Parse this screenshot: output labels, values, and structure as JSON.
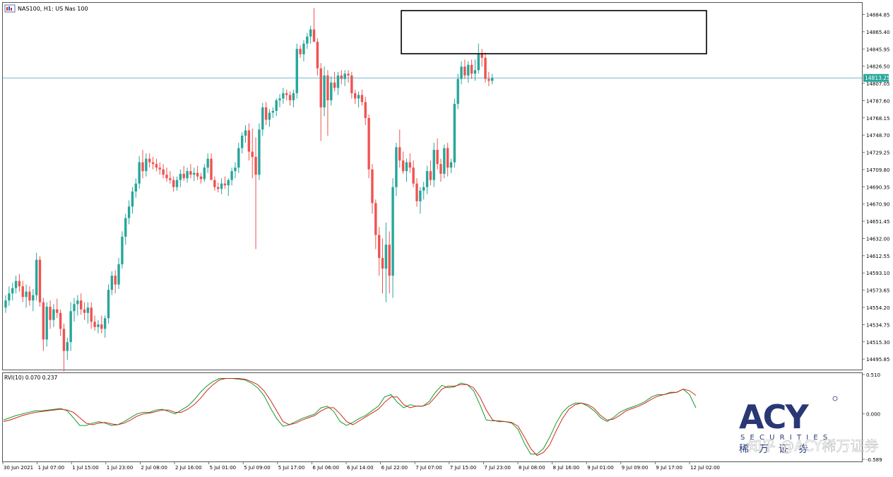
{
  "header": {
    "symbol_title": "NAS100, H1:  US Nas 100"
  },
  "chart_data": [
    {
      "type": "candlestick",
      "title": "NAS100, H1:  US Nas 100",
      "price_axis_ticks": [
        "14884.85",
        "14865.40",
        "14845.95",
        "14826.50",
        "14807.05",
        "14787.60",
        "14768.15",
        "14748.70",
        "14729.25",
        "14709.80",
        "14690.35",
        "14670.90",
        "14651.45",
        "14632.00",
        "14612.55",
        "14593.10",
        "14573.65",
        "14554.20",
        "14534.75",
        "14515.30",
        "14495.85"
      ],
      "ylim": [
        14484.0,
        14898.0
      ],
      "current_price_label": "14813.25",
      "current_price": 14813.25,
      "time_axis_labels": [
        "30 Jun 2021",
        "1 Jul 07:00",
        "1 Jul 15:00",
        "1 Jul 23:00",
        "2 Jul 08:00",
        "2 Jul 16:00",
        "5 Jul 01:00",
        "5 Jul 09:00",
        "5 Jul 17:00",
        "6 Jul 06:00",
        "6 Jul 14:00",
        "6 Jul 22:00",
        "7 Jul 07:00",
        "7 Jul 15:00",
        "7 Jul 23:00",
        "8 Jul 08:00",
        "8 Jul 16:00",
        "9 Jul 01:00",
        "9 Jul 09:00",
        "9 Jul 17:00",
        "12 Jul 02:00"
      ],
      "bull_color": "#26a69a",
      "bear_color": "#ef5350",
      "candles_ohlc": [
        [
          14554,
          14568,
          14548,
          14562
        ],
        [
          14562,
          14578,
          14556,
          14570
        ],
        [
          14570,
          14582,
          14562,
          14576
        ],
        [
          14576,
          14590,
          14570,
          14584
        ],
        [
          14584,
          14592,
          14572,
          14578
        ],
        [
          14578,
          14584,
          14560,
          14566
        ],
        [
          14566,
          14580,
          14554,
          14572
        ],
        [
          14572,
          14578,
          14556,
          14562
        ],
        [
          14562,
          14575,
          14550,
          14568
        ],
        [
          14568,
          14616,
          14562,
          14608
        ],
        [
          14608,
          14612,
          14555,
          14560
        ],
        [
          14560,
          14565,
          14505,
          14518
        ],
        [
          14518,
          14560,
          14510,
          14555
        ],
        [
          14555,
          14562,
          14530,
          14540
        ],
        [
          14540,
          14558,
          14532,
          14552
        ],
        [
          14552,
          14564,
          14542,
          14548
        ],
        [
          14548,
          14552,
          14522,
          14530
        ],
        [
          14530,
          14536,
          14482,
          14505
        ],
        [
          14505,
          14520,
          14495,
          14515
        ],
        [
          14515,
          14560,
          14505,
          14550
        ],
        [
          14550,
          14565,
          14538,
          14558
        ],
        [
          14558,
          14568,
          14545,
          14562
        ],
        [
          14562,
          14570,
          14546,
          14552
        ],
        [
          14552,
          14560,
          14540,
          14548
        ],
        [
          14548,
          14560,
          14536,
          14554
        ],
        [
          14554,
          14560,
          14530,
          14538
        ],
        [
          14538,
          14545,
          14528,
          14532
        ],
        [
          14532,
          14540,
          14525,
          14535
        ],
        [
          14535,
          14545,
          14525,
          14530
        ],
        [
          14530,
          14545,
          14520,
          14542
        ],
        [
          14542,
          14580,
          14536,
          14574
        ],
        [
          14574,
          14595,
          14568,
          14590
        ],
        [
          14590,
          14596,
          14570,
          14580
        ],
        [
          14580,
          14610,
          14575,
          14603
        ],
        [
          14603,
          14640,
          14598,
          14634
        ],
        [
          14634,
          14660,
          14625,
          14655
        ],
        [
          14655,
          14675,
          14648,
          14668
        ],
        [
          14668,
          14690,
          14660,
          14685
        ],
        [
          14685,
          14700,
          14678,
          14694
        ],
        [
          14694,
          14725,
          14688,
          14718
        ],
        [
          14718,
          14732,
          14700,
          14708
        ],
        [
          14708,
          14728,
          14702,
          14722
        ],
        [
          14722,
          14728,
          14712,
          14718
        ],
        [
          14718,
          14724,
          14710,
          14716
        ],
        [
          14716,
          14722,
          14708,
          14712
        ],
        [
          14712,
          14718,
          14704,
          14710
        ],
        [
          14710,
          14716,
          14700,
          14704
        ],
        [
          14704,
          14712,
          14696,
          14700
        ],
        [
          14700,
          14708,
          14694,
          14698
        ],
        [
          14698,
          14702,
          14685,
          14690
        ],
        [
          14690,
          14702,
          14686,
          14698
        ],
        [
          14698,
          14710,
          14690,
          14705
        ],
        [
          14705,
          14714,
          14697,
          14700
        ],
        [
          14700,
          14712,
          14695,
          14708
        ],
        [
          14708,
          14716,
          14700,
          14704
        ],
        [
          14704,
          14712,
          14697,
          14706
        ],
        [
          14706,
          14714,
          14698,
          14702
        ],
        [
          14702,
          14706,
          14694,
          14699
        ],
        [
          14699,
          14716,
          14696,
          14712
        ],
        [
          14712,
          14728,
          14706,
          14722
        ],
        [
          14722,
          14728,
          14700,
          14698
        ],
        [
          14698,
          14702,
          14686,
          14690
        ],
        [
          14690,
          14695,
          14684,
          14688
        ],
        [
          14688,
          14700,
          14682,
          14694
        ],
        [
          14694,
          14702,
          14688,
          14692
        ],
        [
          14692,
          14700,
          14680,
          14698
        ],
        [
          14698,
          14712,
          14692,
          14708
        ],
        [
          14708,
          14718,
          14700,
          14712
        ],
        [
          14712,
          14740,
          14706,
          14734
        ],
        [
          14734,
          14752,
          14728,
          14748
        ],
        [
          14748,
          14760,
          14740,
          14754
        ],
        [
          14754,
          14762,
          14720,
          14730
        ],
        [
          14730,
          14756,
          14700,
          14724
        ],
        [
          14724,
          14746,
          14620,
          14704
        ],
        [
          14704,
          14762,
          14698,
          14755
        ],
        [
          14755,
          14785,
          14748,
          14780
        ],
        [
          14780,
          14786,
          14760,
          14766
        ],
        [
          14766,
          14778,
          14758,
          14774
        ],
        [
          14774,
          14780,
          14768,
          14776
        ],
        [
          14776,
          14790,
          14770,
          14788
        ],
        [
          14788,
          14795,
          14780,
          14790
        ],
        [
          14790,
          14802,
          14784,
          14796
        ],
        [
          14796,
          14800,
          14788,
          14794
        ],
        [
          14794,
          14798,
          14782,
          14788
        ],
        [
          14788,
          14800,
          14780,
          14796
        ],
        [
          14796,
          14852,
          14790,
          14846
        ],
        [
          14846,
          14850,
          14836,
          14840
        ],
        [
          14840,
          14856,
          14832,
          14852
        ],
        [
          14852,
          14864,
          14846,
          14860
        ],
        [
          14860,
          14872,
          14852,
          14868
        ],
        [
          14868,
          14892,
          14858,
          14854
        ],
        [
          14854,
          14858,
          14816,
          14824
        ],
        [
          14824,
          14830,
          14742,
          14780
        ],
        [
          14780,
          14826,
          14770,
          14816
        ],
        [
          14816,
          14822,
          14748,
          14788
        ],
        [
          14788,
          14815,
          14782,
          14808
        ],
        [
          14808,
          14820,
          14798,
          14802
        ],
        [
          14802,
          14820,
          14794,
          14816
        ],
        [
          14816,
          14822,
          14806,
          14812
        ],
        [
          14812,
          14822,
          14804,
          14818
        ],
        [
          14818,
          14822,
          14808,
          14816
        ],
        [
          14816,
          14820,
          14790,
          14796
        ],
        [
          14796,
          14800,
          14784,
          14790
        ],
        [
          14790,
          14798,
          14780,
          14794
        ],
        [
          14794,
          14800,
          14782,
          14786
        ],
        [
          14786,
          14792,
          14760,
          14768
        ],
        [
          14768,
          14772,
          14700,
          14710
        ],
        [
          14710,
          14716,
          14660,
          14672
        ],
        [
          14672,
          14676,
          14620,
          14636
        ],
        [
          14636,
          14645,
          14590,
          14610
        ],
        [
          14610,
          14632,
          14570,
          14598
        ],
        [
          14598,
          14650,
          14560,
          14625
        ],
        [
          14625,
          14640,
          14570,
          14590
        ],
        [
          14590,
          14700,
          14565,
          14690
        ],
        [
          14690,
          14740,
          14680,
          14735
        ],
        [
          14735,
          14755,
          14712,
          14720
        ],
        [
          14720,
          14730,
          14705,
          14708
        ],
        [
          14708,
          14722,
          14696,
          14718
        ],
        [
          14718,
          14728,
          14706,
          14712
        ],
        [
          14712,
          14720,
          14690,
          14694
        ],
        [
          14694,
          14700,
          14668,
          14674
        ],
        [
          14674,
          14690,
          14660,
          14686
        ],
        [
          14686,
          14696,
          14676,
          14690
        ],
        [
          14690,
          14714,
          14682,
          14708
        ],
        [
          14708,
          14720,
          14692,
          14698
        ],
        [
          14698,
          14740,
          14690,
          14732
        ],
        [
          14732,
          14745,
          14710,
          14716
        ],
        [
          14716,
          14722,
          14696,
          14705
        ],
        [
          14705,
          14738,
          14700,
          14734
        ],
        [
          14734,
          14740,
          14702,
          14712
        ],
        [
          14712,
          14722,
          14706,
          14718
        ],
        [
          14718,
          14790,
          14712,
          14784
        ],
        [
          14784,
          14818,
          14778,
          14812
        ],
        [
          14812,
          14832,
          14806,
          14826
        ],
        [
          14826,
          14834,
          14812,
          14816
        ],
        [
          14816,
          14832,
          14808,
          14828
        ],
        [
          14828,
          14834,
          14812,
          14818
        ],
        [
          14818,
          14834,
          14810,
          14822
        ],
        [
          14822,
          14852,
          14818,
          14840
        ],
        [
          14840,
          14846,
          14826,
          14836
        ],
        [
          14836,
          14842,
          14808,
          14812
        ],
        [
          14812,
          14820,
          14804,
          14810
        ],
        [
          14810,
          14818,
          14806,
          14813
        ]
      ]
    },
    {
      "type": "line",
      "title": "RVI(10) 0.070 0.237",
      "axis_ticks": [
        "0.510",
        "0.000",
        "-0.589"
      ],
      "ylim": [
        -0.589,
        0.51
      ],
      "series": [
        {
          "color": "#169a2a",
          "values": [
            -0.08,
            -0.05,
            -0.02,
            0.0,
            0.02,
            0.04,
            0.04,
            0.05,
            0.06,
            0.07,
            0.04,
            -0.05,
            -0.15,
            -0.15,
            -0.12,
            -0.1,
            -0.12,
            -0.15,
            -0.14,
            -0.1,
            -0.05,
            0.0,
            0.02,
            0.02,
            0.05,
            0.06,
            0.03,
            0.0,
            0.05,
            0.1,
            0.18,
            0.28,
            0.36,
            0.42,
            0.46,
            0.46,
            0.46,
            0.45,
            0.44,
            0.4,
            0.34,
            0.24,
            0.08,
            -0.06,
            -0.16,
            -0.14,
            -0.1,
            -0.06,
            -0.03,
            0.0,
            0.08,
            0.1,
            0.03,
            -0.1,
            -0.15,
            -0.11,
            -0.06,
            -0.02,
            0.04,
            0.1,
            0.22,
            0.25,
            0.15,
            0.08,
            0.12,
            0.1,
            0.1,
            0.16,
            0.28,
            0.37,
            0.34,
            0.35,
            0.4,
            0.38,
            0.3,
            0.12,
            -0.08,
            -0.09,
            -0.09,
            -0.1,
            -0.12,
            -0.2,
            -0.38,
            -0.52,
            -0.52,
            -0.45,
            -0.3,
            -0.12,
            0.02,
            0.1,
            0.14,
            0.14,
            0.1,
            0.04,
            -0.05,
            -0.1,
            -0.05,
            0.02,
            0.06,
            0.09,
            0.12,
            0.16,
            0.22,
            0.25,
            0.25,
            0.28,
            0.28,
            0.32,
            0.25,
            0.08
          ]
        },
        {
          "color": "#d0261c",
          "values": [
            -0.1,
            -0.08,
            -0.05,
            -0.02,
            0.0,
            0.02,
            0.03,
            0.04,
            0.05,
            0.06,
            0.05,
            0.02,
            -0.05,
            -0.12,
            -0.14,
            -0.12,
            -0.11,
            -0.13,
            -0.14,
            -0.12,
            -0.08,
            -0.03,
            0.0,
            0.01,
            0.03,
            0.05,
            0.05,
            0.02,
            0.02,
            0.06,
            0.12,
            0.2,
            0.3,
            0.38,
            0.44,
            0.46,
            0.46,
            0.46,
            0.45,
            0.42,
            0.38,
            0.3,
            0.18,
            0.04,
            -0.1,
            -0.14,
            -0.12,
            -0.08,
            -0.05,
            -0.02,
            0.04,
            0.08,
            0.08,
            0.0,
            -0.1,
            -0.14,
            -0.09,
            -0.04,
            0.01,
            0.06,
            0.15,
            0.22,
            0.22,
            0.12,
            0.08,
            0.1,
            0.1,
            0.13,
            0.22,
            0.32,
            0.36,
            0.36,
            0.38,
            0.38,
            0.34,
            0.22,
            0.05,
            -0.08,
            -0.1,
            -0.1,
            -0.11,
            -0.16,
            -0.3,
            -0.45,
            -0.54,
            -0.5,
            -0.4,
            -0.22,
            -0.06,
            0.06,
            0.12,
            0.14,
            0.12,
            0.07,
            -0.02,
            -0.08,
            -0.07,
            -0.02,
            0.04,
            0.07,
            0.1,
            0.14,
            0.19,
            0.23,
            0.25,
            0.27,
            0.28,
            0.32,
            0.3,
            0.24
          ]
        }
      ]
    }
  ],
  "watermark": {
    "logo_text": "ACY",
    "securities_text": "S E C U R I T I E S",
    "chinese_text": "稀万证券",
    "zhihu_text": "知乎 @ACY稀万证券"
  }
}
